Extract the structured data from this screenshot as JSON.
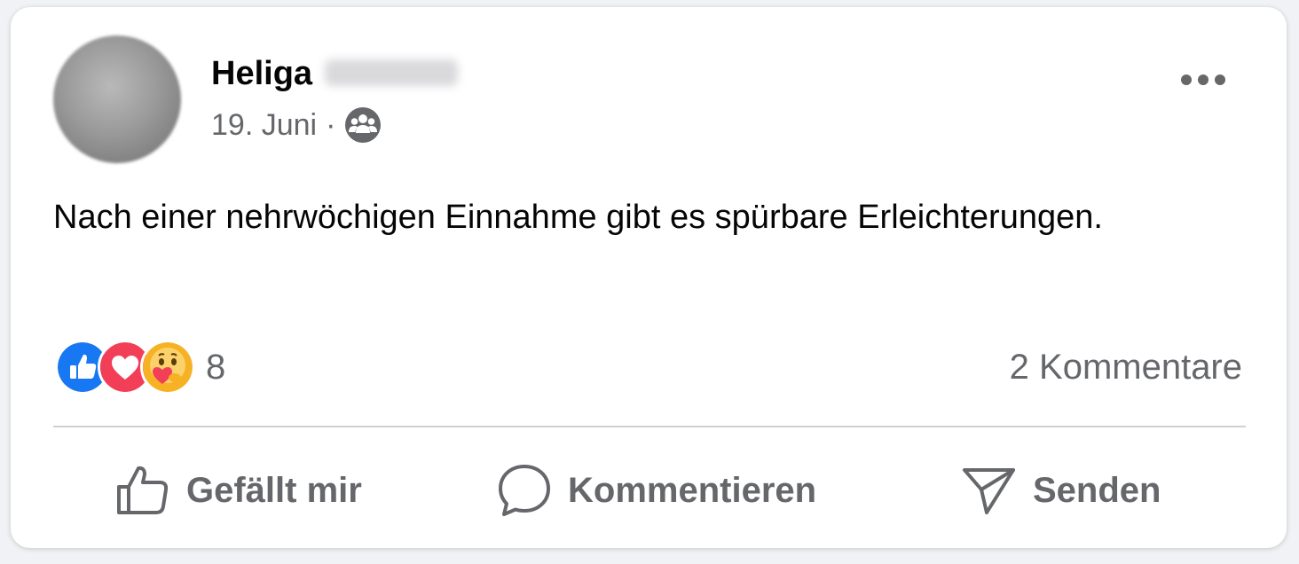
{
  "post": {
    "author_name": "Heliga",
    "author_name_redacted": true,
    "date": "19. Juni",
    "separator": "·",
    "audience_icon": "friends-icon",
    "text": "Nach einer nehrwöchigen Einnahme gibt es spürbare Erleichterungen."
  },
  "engagement": {
    "reaction_icons": [
      "like-reaction-icon",
      "love-reaction-icon",
      "care-reaction-icon"
    ],
    "reaction_count": "8",
    "comments_label": "2 Kommentare"
  },
  "actions": {
    "like_label": "Gefällt mir",
    "comment_label": "Kommentieren",
    "send_label": "Senden"
  },
  "colors": {
    "like_blue": "#1877f2",
    "love_red": "#f33e58",
    "care_yellow": "#f7b125",
    "secondary_text": "#65676b"
  }
}
